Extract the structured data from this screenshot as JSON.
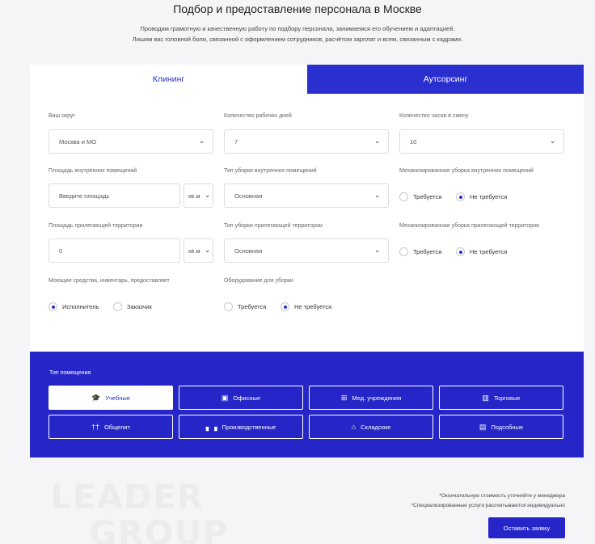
{
  "header": {
    "title": "Подбор и предоставление персонала в Москве",
    "subtitle_line1": "Проводим грамотную и качественную работу по подбору персонала, занимаемся его обучением и адаптацией.",
    "subtitle_line2": "Лишим вас головной боли, связанной с оформлением сотрудников, расчётом зарплат и всем, связанным с кадрами."
  },
  "tabs": {
    "cleaning": "Клининг",
    "outsourcing": "Аутсорсинг"
  },
  "form": {
    "district": {
      "label": "Ваш округ",
      "value": "Москва и МО"
    },
    "workdays": {
      "label": "Количество рабочих дней",
      "value": "7"
    },
    "hours": {
      "label": "Количество часов в смену",
      "value": "10"
    },
    "inner_area": {
      "label": "Площадь внутренних помещений",
      "placeholder": "Введите площадь",
      "unit": "кв.м"
    },
    "inner_type": {
      "label": "Тип уборки внутренних помещений",
      "value": "Основная"
    },
    "inner_mech": {
      "label": "Механизированная уборка внутренних помещений",
      "opt1": "Требуется",
      "opt2": "Не требуется"
    },
    "outer_area": {
      "label": "Площадь прилегающей территории",
      "value": "0",
      "unit": "кв.м"
    },
    "outer_type": {
      "label": "Тип уборки прилегающей территории",
      "value": "Основная"
    },
    "outer_mech": {
      "label": "Механизированная уборка прилегающей территории",
      "opt1": "Требуется",
      "opt2": "Не требуется"
    },
    "supplies": {
      "label": "Моющие средства, инвентарь, предоставляет",
      "opt1": "Исполнитель",
      "opt2": "Заказчик"
    },
    "equipment": {
      "label": "Оборудование для уборки",
      "opt1": "Требуется",
      "opt2": "Не требуется"
    }
  },
  "premises": {
    "label": "Тип помещения",
    "items": [
      "Учебные",
      "Офисные",
      "Мед. учреждения",
      "Торговые",
      "Общепит",
      "Производственные",
      "Складские",
      "Подсобные"
    ]
  },
  "footer": {
    "logo_line1": "LEADER",
    "logo_line2": "GROUP",
    "note1": "*Окончательную стоимость уточняйте у менеджера",
    "note2": "*Специализированные услуги рассчитываются индивидуально",
    "cta": "Оставить заявку"
  }
}
